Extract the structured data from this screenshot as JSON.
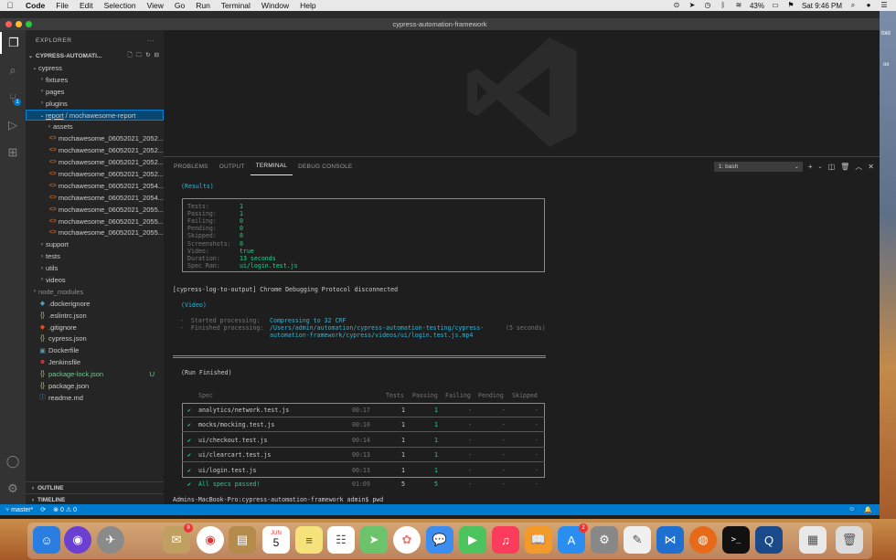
{
  "menubar": {
    "app_name": "Code",
    "menus": [
      "File",
      "Edit",
      "Selection",
      "View",
      "Go",
      "Run",
      "Terminal",
      "Window",
      "Help"
    ],
    "battery": "43%",
    "clock": "Sat 9:46 PM"
  },
  "window": {
    "title": "cypress-automation-framework"
  },
  "explorer": {
    "header": "EXPLORER",
    "more": "···",
    "project": "CYPRESS-AUTOMATI...",
    "items": [
      {
        "label": "cypress",
        "type": "folder-open",
        "indent": 1
      },
      {
        "label": "fixtures",
        "type": "folder",
        "indent": 2
      },
      {
        "label": "pages",
        "type": "folder",
        "indent": 2
      },
      {
        "label": "plugins",
        "type": "folder",
        "indent": 2
      },
      {
        "label": "report",
        "label2": " / mochawesome-report",
        "type": "folder-open-selected",
        "indent": 2
      },
      {
        "label": "assets",
        "type": "folder",
        "indent": 3
      },
      {
        "label": "mochawesome_06052021_2052...",
        "type": "html",
        "indent": 3
      },
      {
        "label": "mochawesome_06052021_2052...",
        "type": "html",
        "indent": 3
      },
      {
        "label": "mochawesome_06052021_2052...",
        "type": "html",
        "indent": 3
      },
      {
        "label": "mochawesome_06052021_2052...",
        "type": "html",
        "indent": 3
      },
      {
        "label": "mochawesome_06052021_2054...",
        "type": "html",
        "indent": 3
      },
      {
        "label": "mochawesome_06052021_2054...",
        "type": "html",
        "indent": 3
      },
      {
        "label": "mochawesome_06052021_2055...",
        "type": "html",
        "indent": 3
      },
      {
        "label": "mochawesome_06052021_2055...",
        "type": "html",
        "indent": 3
      },
      {
        "label": "mochawesome_06052021_2055...",
        "type": "html",
        "indent": 3
      },
      {
        "label": "support",
        "type": "folder",
        "indent": 2
      },
      {
        "label": "tests",
        "type": "folder",
        "indent": 2
      },
      {
        "label": "utils",
        "type": "folder",
        "indent": 2
      },
      {
        "label": "videos",
        "type": "folder",
        "indent": 2
      },
      {
        "label": "node_modules",
        "type": "folder-dim",
        "indent": 1
      },
      {
        "label": ".dockerignore",
        "type": "docker-ignore",
        "indent": 1
      },
      {
        "label": ".eslintrc.json",
        "type": "json",
        "indent": 1
      },
      {
        "label": ".gitignore",
        "type": "git",
        "indent": 1
      },
      {
        "label": "cypress.json",
        "type": "json",
        "indent": 1
      },
      {
        "label": "Dockerfile",
        "type": "docker",
        "indent": 1
      },
      {
        "label": "Jenkinsfile",
        "type": "jenkins",
        "indent": 1
      },
      {
        "label": "package-lock.json",
        "type": "json-modified",
        "indent": 1,
        "status": "U"
      },
      {
        "label": "package.json",
        "type": "json",
        "indent": 1
      },
      {
        "label": "readme.md",
        "type": "info",
        "indent": 1
      }
    ],
    "outline": "OUTLINE",
    "timeline": "TIMELINE"
  },
  "panel": {
    "tabs": [
      "PROBLEMS",
      "OUTPUT",
      "TERMINAL",
      "DEBUG CONSOLE"
    ],
    "active_tab": "TERMINAL",
    "terminal_select": "1: bash"
  },
  "terminal": {
    "results_heading": "(Results)",
    "results": [
      {
        "key": "Tests:",
        "value": "1"
      },
      {
        "key": "Passing:",
        "value": "1"
      },
      {
        "key": "Failing:",
        "value": "0"
      },
      {
        "key": "Pending:",
        "value": "0"
      },
      {
        "key": "Skipped:",
        "value": "0"
      },
      {
        "key": "Screenshots:",
        "value": "0"
      },
      {
        "key": "Video:",
        "value": "true"
      },
      {
        "key": "Duration:",
        "value": "13 seconds"
      },
      {
        "key": "Spec Ran:",
        "value": "ui/login.test.js"
      }
    ],
    "log_line": "[cypress-log-to-output] Chrome Debugging Protocol disconnected",
    "video_heading": "(Video)",
    "started_label": "-  Started processing:",
    "started_value": "Compressing to 32 CRF",
    "finished_label": "-  Finished processing:",
    "finished_value_1": "/Users/admin/automation/cypress-automation-testing/cypress-",
    "finished_value_2": "automation-framework/cypress/videos/ui/login.test.js.mp4",
    "finished_time": "(5 seconds)",
    "run_finished": "(Run Finished)",
    "columns": [
      "Spec",
      "Tests",
      "Passing",
      "Failing",
      "Pending",
      "Skipped"
    ],
    "rows": [
      {
        "check": "✔",
        "spec": "analytics/network.test.js",
        "time": "00:17",
        "tests": "1",
        "passing": "1",
        "failing": "-",
        "pending": "-",
        "skipped": "-"
      },
      {
        "check": "✔",
        "spec": "mocks/mocking.test.js",
        "time": "00:10",
        "tests": "1",
        "passing": "1",
        "failing": "-",
        "pending": "-",
        "skipped": "-"
      },
      {
        "check": "✔",
        "spec": "ui/checkout.test.js",
        "time": "00:14",
        "tests": "1",
        "passing": "1",
        "failing": "-",
        "pending": "-",
        "skipped": "-"
      },
      {
        "check": "✔",
        "spec": "ui/clearcart.test.js",
        "time": "00:13",
        "tests": "1",
        "passing": "1",
        "failing": "-",
        "pending": "-",
        "skipped": "-"
      },
      {
        "check": "✔",
        "spec": "ui/login.test.js",
        "time": "00:13",
        "tests": "1",
        "passing": "1",
        "failing": "-",
        "pending": "-",
        "skipped": "-"
      }
    ],
    "summary": {
      "check": "✔",
      "label": "All specs passed!",
      "time": "01:09",
      "tests": "5",
      "passing": "5",
      "failing": "-",
      "pending": "-",
      "skipped": "-"
    },
    "prompt": "Admins-MacBook-Pro:cypress-automation-framework admin$ pwd"
  },
  "statusbar": {
    "branch": "master*",
    "errors": "0",
    "warnings": "0"
  },
  "dock": {
    "calendar_month": "JUN",
    "calendar_day": "5",
    "contacts_badge": "9",
    "appstore_badge": "2"
  },
  "desktop": {
    "label_1": "fold",
    "label_2": "ox"
  }
}
